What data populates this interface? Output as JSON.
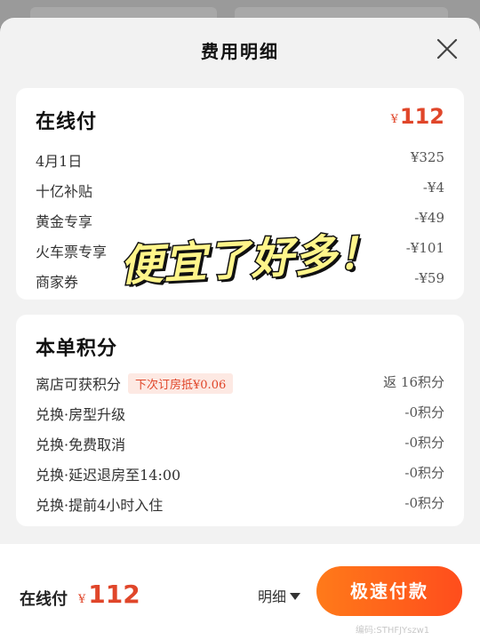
{
  "sheet": {
    "title": "费用明细"
  },
  "payment": {
    "title": "在线付",
    "currency": "¥",
    "amount": "112",
    "rows": [
      {
        "label": "4月1日",
        "value": "¥325"
      },
      {
        "label": "十亿补贴",
        "value": "-¥4"
      },
      {
        "label": "黄金专享",
        "value": "-¥49"
      },
      {
        "label": "火车票专享",
        "value": "-¥101"
      },
      {
        "label": "商家券",
        "value": "-¥59"
      }
    ]
  },
  "points": {
    "title": "本单积分",
    "rows": [
      {
        "label": "离店可获积分",
        "tag": "下次订房抵¥0.06",
        "value": "返 16积分"
      },
      {
        "label": "兑换·房型升级",
        "value": "-0积分"
      },
      {
        "label": "兑换·免费取消",
        "value": "-0积分"
      },
      {
        "label": "兑换·延迟退房至14:00",
        "value": "-0积分"
      },
      {
        "label": "兑换·提前4小时入住",
        "value": "-0积分"
      }
    ]
  },
  "sticker": {
    "text": "便宜了好多！"
  },
  "bottom": {
    "label": "在线付",
    "currency": "¥",
    "amount": "112",
    "detail_label": "明细",
    "pay_button": "极速付款",
    "watermark": "编码:STHFJYszw1"
  },
  "colors": {
    "accent": "#e0462a",
    "button_start": "#ff7a1a",
    "button_end": "#ff4d1c"
  },
  "icons": {
    "close": "close-icon",
    "caret": "caret-down-icon"
  }
}
